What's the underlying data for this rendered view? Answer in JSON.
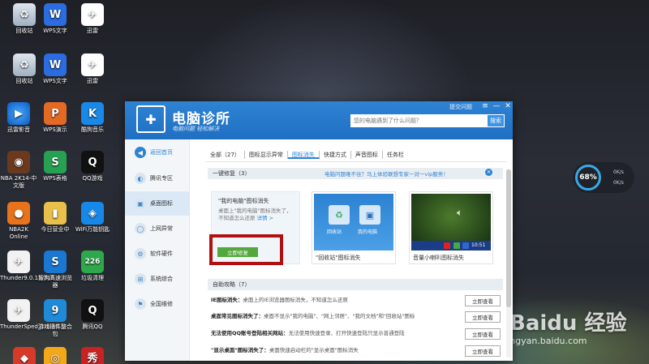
{
  "desktop": {
    "icons": [
      {
        "label": "回收站",
        "glyph": "♻",
        "cls": "g-bin"
      },
      {
        "label": "WPS文字",
        "glyph": "W",
        "cls": "g-wps"
      },
      {
        "label": "迅雷",
        "glyph": "✈",
        "cls": "g-xunlei"
      },
      {
        "label": "回收站",
        "glyph": "♻",
        "cls": "g-bin"
      },
      {
        "label": "WPS文字",
        "glyph": "W",
        "cls": "g-wps"
      },
      {
        "label": "迅雷",
        "glyph": "✈",
        "cls": "g-xunlei"
      },
      {
        "label": "迅雷影音",
        "glyph": "▶",
        "cls": "g-film"
      },
      {
        "label": "WPS演示",
        "glyph": "P",
        "cls": "g-show"
      },
      {
        "label": "酷狗音乐",
        "glyph": "K",
        "cls": "g-kugou"
      },
      {
        "label": "NBA 2K14-中文版",
        "glyph": "◉",
        "cls": "g-nba"
      },
      {
        "label": "WPS表格",
        "glyph": "S",
        "cls": "g-sheet"
      },
      {
        "label": "QQ游戏",
        "glyph": "Q",
        "cls": "g-qq"
      },
      {
        "label": "NBA2K Online",
        "glyph": "●",
        "cls": "g-ball"
      },
      {
        "label": "今日营业中",
        "glyph": "▮",
        "cls": "g-folder"
      },
      {
        "label": "WiFi万能钥匙",
        "glyph": "◈",
        "cls": "g-wifi"
      },
      {
        "label": "Thunder9.0.11.318",
        "glyph": "✈",
        "cls": "g-thunder"
      },
      {
        "label": "搜狗高速浏览器",
        "glyph": "S",
        "cls": "g-browser"
      },
      {
        "label": "垃圾清理",
        "glyph": "226",
        "cls": "g-clean"
      },
      {
        "label": "ThunderSped_1.0.33....",
        "glyph": "✈",
        "cls": "g-thunder"
      },
      {
        "label": "游戏插件整合包",
        "glyph": "9",
        "cls": "g-nine"
      },
      {
        "label": "腾讯QQ",
        "glyph": "Q",
        "cls": "g-qq2"
      },
      {
        "label": "",
        "glyph": "◆",
        "cls": "g-misc1"
      },
      {
        "label": "",
        "glyph": "◎",
        "cls": "g-misc2"
      },
      {
        "label": "",
        "glyph": "秀",
        "cls": "g-misc3"
      }
    ]
  },
  "net_widget": {
    "percent": "68%",
    "up": "0K/s",
    "down": "0K/s"
  },
  "watermark": {
    "brand": "Baidu 经验",
    "url": "jingyan.baidu.com"
  },
  "window": {
    "title": "电脑诊所",
    "subtitle": "电脑问题 轻松解决",
    "feedback": "提交问题",
    "controls": [
      "≡",
      "—",
      "✕"
    ],
    "search_placeholder": "您的电脑遇到了什么问题？",
    "search_button": "搜索",
    "sidebar": [
      {
        "label": "返回首页",
        "icon": "◀"
      },
      {
        "label": "腾讯专区",
        "icon": "◐"
      },
      {
        "label": "桌面图标",
        "icon": "▣"
      },
      {
        "label": "上网异常",
        "icon": "◯"
      },
      {
        "label": "软件硬件",
        "icon": "⚙"
      },
      {
        "label": "系统综合",
        "icon": "⊞"
      },
      {
        "label": "全国维修",
        "icon": "⚑"
      }
    ],
    "tabs": [
      "全部（27）",
      "图标显示异常",
      "图标消失",
      "快捷方式",
      "声音图标",
      "任务栏"
    ],
    "section1": {
      "title": "一键修复（3）",
      "link": "电脑问题难不住？马上体验联想专家一对一vip服务！",
      "close": "✕"
    },
    "card_mycomputer": {
      "title": "\"我的电脑\"图标消失",
      "desc": "桌面上\"我的电脑\"图标消失了，不知道怎么还原",
      "more": "详情 >",
      "button": "立即修复"
    },
    "card_recycle": {
      "caption": "\"回收站\"图标消失",
      "bin_label": "回收站",
      "pc_label": "我的电脑"
    },
    "card_speaker": {
      "caption": "音量小喇叭图标消失",
      "time": "10:51"
    },
    "section2": {
      "title": "自助攻略（7）"
    },
    "guides": [
      {
        "title": "IE图标消失：",
        "desc": "桌面上的IE浏览器图标消失，不知道怎么还原",
        "button": "立即查看"
      },
      {
        "title": "桌面常见图标消失了：",
        "desc": "桌面不显示\"我的电脑\"、\"网上邻居\"、\"我的文档\"和\"回收站\"图标",
        "button": "立即查看"
      },
      {
        "title": "无法使用QQ账号登陆相关网站：",
        "desc": "无法使用快速登录、打开快速登陆只显示普通登陆",
        "button": "立即查看"
      },
      {
        "title": "\"显示桌面\"图标消失了：",
        "desc": "桌面快速启动栏的\"显示桌面\"图标消失",
        "button": "立即查看"
      }
    ]
  }
}
